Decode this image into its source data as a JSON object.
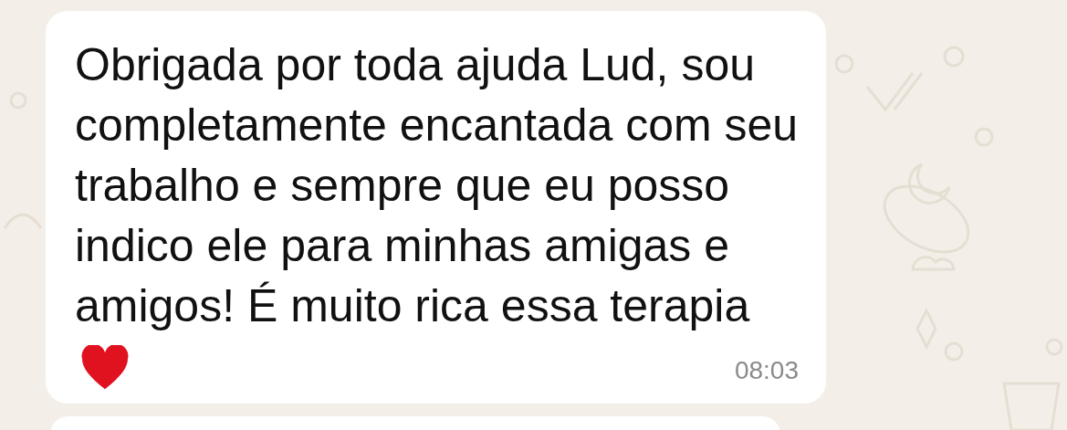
{
  "messages": [
    {
      "text": "Obrigada por toda ajuda Lud, sou completamente encantada com seu trabalho e sempre que eu posso indico ele para minhas amigas e amigos! É muito rica essa terapia",
      "time": "08:03"
    }
  ]
}
